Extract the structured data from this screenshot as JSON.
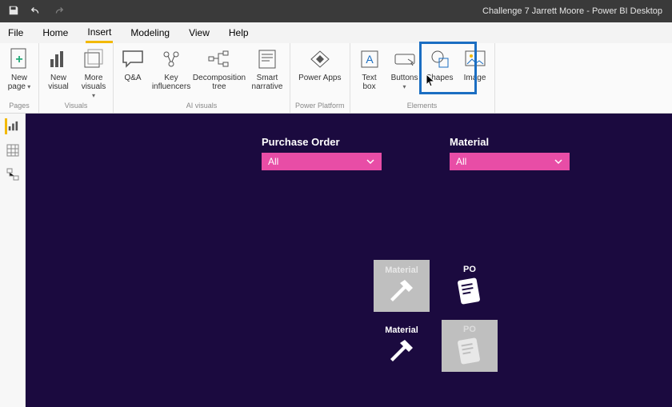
{
  "titlebar": {
    "title": "Challenge 7 Jarrett Moore - Power BI Desktop"
  },
  "menubar": {
    "file": "File",
    "tabs": [
      "Home",
      "Insert",
      "Modeling",
      "View",
      "Help"
    ],
    "active_index": 1
  },
  "ribbon": {
    "groups": [
      {
        "label": "Pages",
        "buttons": [
          {
            "name": "new-page",
            "label": "New\npage"
          }
        ]
      },
      {
        "label": "Visuals",
        "buttons": [
          {
            "name": "new-visual",
            "label": "New\nvisual"
          },
          {
            "name": "more-visuals",
            "label": "More\nvisuals"
          }
        ]
      },
      {
        "label": "AI visuals",
        "buttons": [
          {
            "name": "qna",
            "label": "Q&A"
          },
          {
            "name": "key-influencers",
            "label": "Key\ninfluencers"
          },
          {
            "name": "decomposition-tree",
            "label": "Decomposition\ntree"
          },
          {
            "name": "smart-narrative",
            "label": "Smart\nnarrative"
          }
        ]
      },
      {
        "label": "Power Platform",
        "buttons": [
          {
            "name": "power-apps",
            "label": "Power Apps"
          }
        ]
      },
      {
        "label": "Elements",
        "buttons": [
          {
            "name": "text-box",
            "label": "Text\nbox"
          },
          {
            "name": "buttons",
            "label": "Buttons"
          },
          {
            "name": "shapes",
            "label": "Shapes"
          },
          {
            "name": "image",
            "label": "Image"
          }
        ]
      }
    ]
  },
  "canvas": {
    "slicers": [
      {
        "label": "Purchase Order",
        "value": "All"
      },
      {
        "label": "Material",
        "value": "All"
      }
    ],
    "tiles": [
      {
        "label": "Material",
        "style": "grey-light"
      },
      {
        "label": "PO",
        "style": "dark"
      },
      {
        "label": "Material",
        "style": "dark"
      },
      {
        "label": "PO",
        "style": "grey"
      }
    ]
  }
}
